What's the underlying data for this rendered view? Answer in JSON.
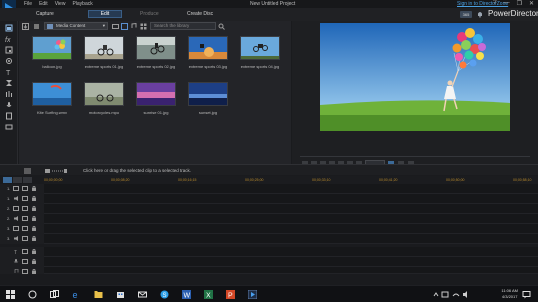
{
  "titlebar": {
    "menu": [
      "File",
      "Edit",
      "View",
      "Playback"
    ],
    "title": "New Untitled Project",
    "signin": "Sign in to DirectorZone",
    "window_controls": [
      "?",
      "—",
      "❐",
      "✕"
    ]
  },
  "modes": {
    "capture": "Capture",
    "edit": "Edit",
    "produce": "Produce",
    "create_disc": "Create Disc",
    "badge": "365",
    "brand": "PowerDirector"
  },
  "library": {
    "content_dropdown": "Media Content",
    "search_placeholder": "Search the library",
    "items": [
      {
        "label": "balloon.jpg",
        "kind": "balloon"
      },
      {
        "label": "extreme sports 01.jpg",
        "kind": "bike1"
      },
      {
        "label": "extreme sports 02.jpg",
        "kind": "bike2"
      },
      {
        "label": "extreme sports 03.jpg",
        "kind": "bike3"
      },
      {
        "label": "extreme sports 04.jpg",
        "kind": "bike4"
      },
      {
        "label": "Kite Surfing.wmv",
        "kind": "kite"
      },
      {
        "label": "motorcycles.mpo",
        "kind": "moto"
      },
      {
        "label": "sunrise 01.jpg",
        "kind": "sunrise"
      },
      {
        "label": "sunset.jpg",
        "kind": "sunset"
      }
    ]
  },
  "timeline": {
    "hint": "Click here or drag the selected clip to a selected track.",
    "ruler_ticks": [
      "00;00;00;00",
      "00;00;08;20",
      "00;00;16;15",
      "00;00;25;00",
      "00;00;33;10",
      "00;00;41;20",
      "00;00;50;00",
      "00;00;58;10"
    ],
    "tracks": [
      {
        "num": "1."
      },
      {
        "num": "1."
      },
      {
        "num": "2."
      },
      {
        "num": "2."
      },
      {
        "num": "3."
      },
      {
        "num": "3."
      },
      {
        "num": ""
      },
      {
        "num": ""
      },
      {
        "num": ""
      }
    ]
  },
  "taskbar": {
    "time": "11:06 AM",
    "date": "4/3/2017"
  },
  "colors": {
    "accent": "#3c6a98",
    "brand_blue": "#4a9fe0",
    "ruler": "#b88a2c"
  }
}
